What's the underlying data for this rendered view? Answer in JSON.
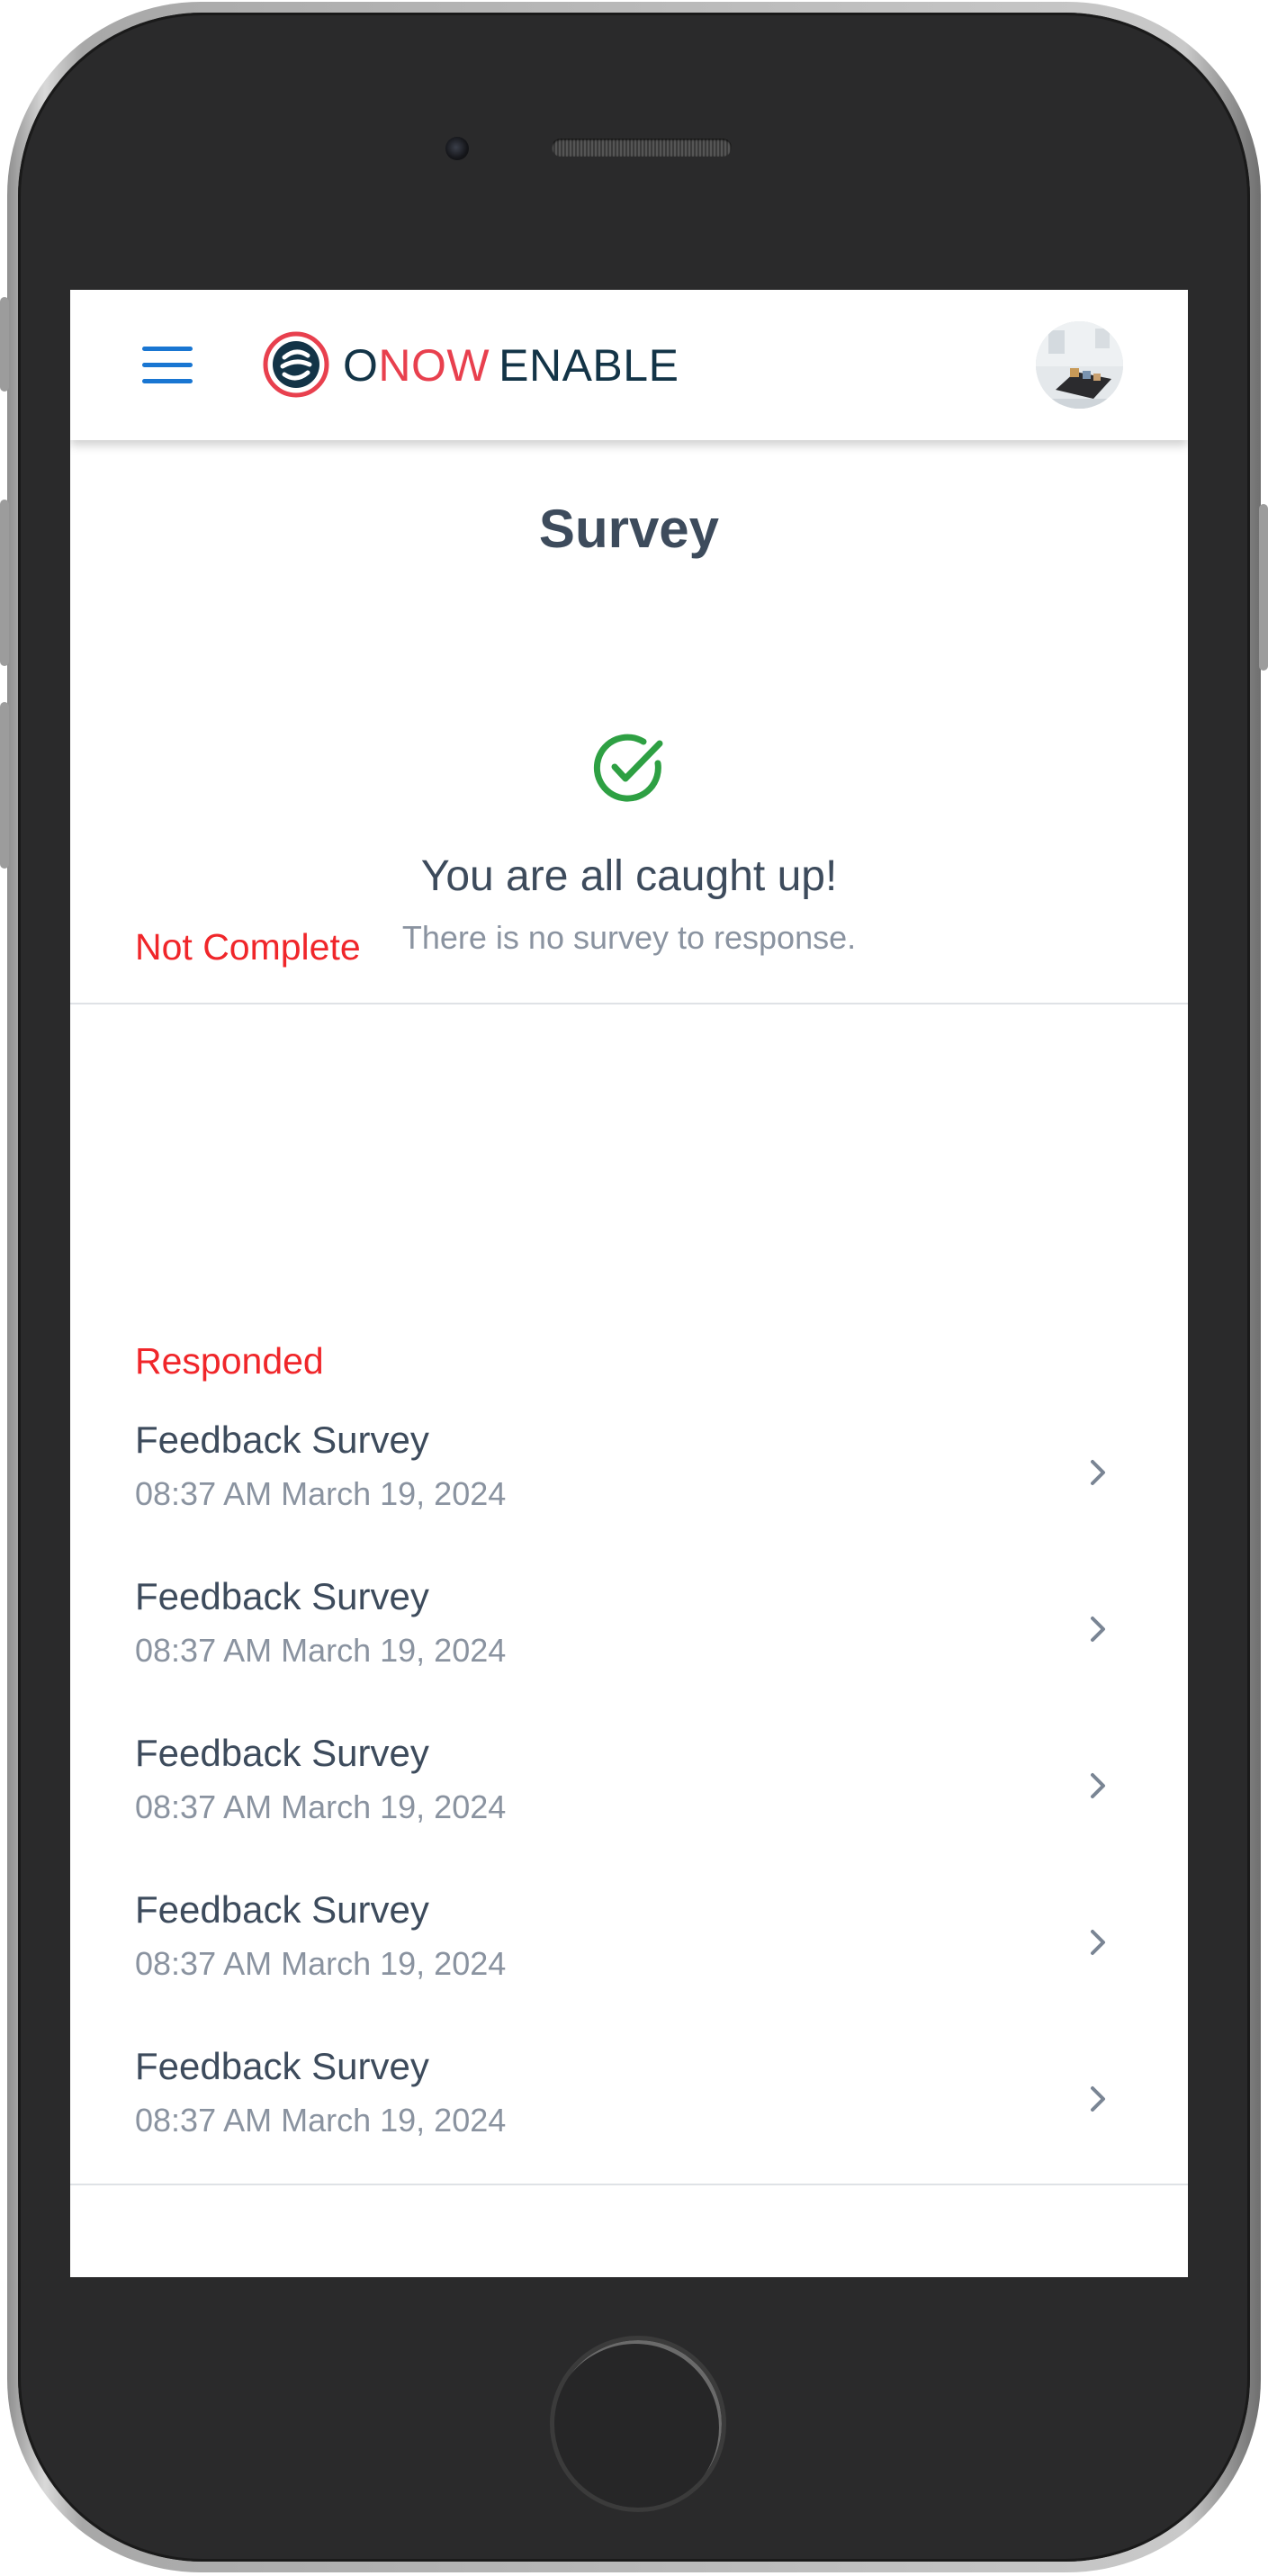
{
  "app": {
    "logo": {
      "o": "O",
      "now": "NOW",
      "enable": "ENABLE"
    },
    "icons": {
      "menu": "hamburger-menu-icon",
      "avatar": "user-avatar",
      "check": "check-circle-icon",
      "chevron": "chevron-right-icon"
    }
  },
  "page": {
    "title": "Survey"
  },
  "not_complete": {
    "label": "Not Complete",
    "empty_title": "You are all caught up!",
    "empty_subtitle": "There is no survey to response."
  },
  "responded": {
    "label": "Responded",
    "items": [
      {
        "title": "Feedback Survey",
        "date": "08:37 AM March 19, 2024"
      },
      {
        "title": "Feedback Survey",
        "date": "08:37 AM March 19, 2024"
      },
      {
        "title": "Feedback Survey",
        "date": "08:37 AM March 19, 2024"
      },
      {
        "title": "Feedback Survey",
        "date": "08:37 AM March 19, 2024"
      },
      {
        "title": "Feedback Survey",
        "date": "08:37 AM March 19, 2024"
      }
    ]
  },
  "colors": {
    "accent_blue": "#1976d2",
    "section_red": "#f0262a",
    "check_green": "#2ea043",
    "brand_red": "#e8404e",
    "brand_navy": "#133447"
  }
}
